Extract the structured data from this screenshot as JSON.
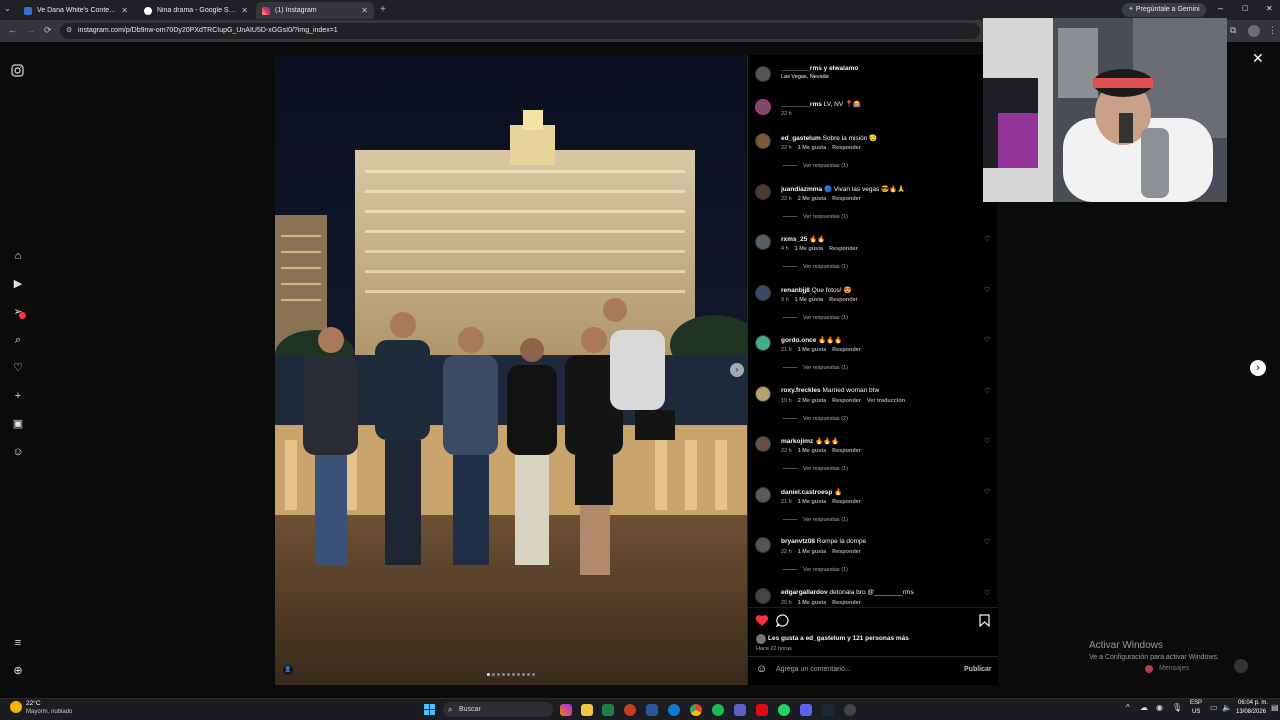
{
  "browser": {
    "tabs": [
      {
        "label": "Ve Dana White's Contender Se",
        "active": false
      },
      {
        "label": "Nina drama - Google Search",
        "active": false
      },
      {
        "label": "(1) Instagram",
        "active": true
      }
    ],
    "url": "instagram.com/p/Db9nw-om70Dy20PXdTRCIupG_UnAIU5D-xGGsI0/?img_index=1",
    "gemini_label": "Pregúntale a Gemini"
  },
  "post": {
    "header_user": "________rms y elwalamo",
    "location": "Las Vegas, Nevada",
    "caption_user": "________rms",
    "caption_text": "LV, NV 📍🎰",
    "caption_time": "22 h",
    "likes_text": "Les gusta a ed_gastelum y 121 personas más",
    "posted_time": "Hace 22 horas",
    "comment_placeholder": "Agrega un comentario...",
    "publish_label": "Publicar"
  },
  "comments": [
    {
      "user": "ed_gastelum",
      "text": "Sobre la misión 🫡",
      "time": "22 h",
      "likes": "1 Me gusta",
      "reply": "Responder",
      "replies": "Ver respuestas (1)",
      "heart": false
    },
    {
      "user": "juandiazmma",
      "text": "🔵 Vivan las vegas 😎🔥🙏",
      "time": "22 h",
      "likes": "2 Me gusta",
      "reply": "Responder",
      "replies": "Ver respuestas (1)",
      "heart": false
    },
    {
      "user": "rxms_25",
      "text": "🔥🔥",
      "time": "4 h",
      "likes": "1 Me gusta",
      "reply": "Responder",
      "replies": "Ver respuestas (1)",
      "heart": true
    },
    {
      "user": "renanbjj8",
      "text": "Que fotos! 😍",
      "time": "9 h",
      "likes": "1 Me gusta",
      "reply": "Responder",
      "replies": "Ver respuestas (1)",
      "heart": true
    },
    {
      "user": "gordo.once",
      "text": "🔥🔥🔥",
      "time": "21 h",
      "likes": "1 Me gusta",
      "reply": "Responder",
      "replies": "Ver respuestas (1)",
      "heart": true
    },
    {
      "user": "roxy.freckles",
      "text": "Married woman btw",
      "time": "19 h",
      "likes": "2 Me gusta",
      "reply": "Responder",
      "translate": "Ver traducción",
      "replies": "Ver respuestas (2)",
      "heart": true
    },
    {
      "user": "markojimz",
      "text": "🔥🔥🔥",
      "time": "22 h",
      "likes": "1 Me gusta",
      "reply": "Responder",
      "replies": "Ver respuestas (1)",
      "heart": true
    },
    {
      "user": "daniel.castroesp",
      "text": "🔥",
      "time": "21 h",
      "likes": "1 Me gusta",
      "reply": "Responder",
      "replies": "Ver respuestas (1)",
      "heart": true
    },
    {
      "user": "bryanvtz08",
      "text": "Rompe la dompe",
      "time": "22 h",
      "likes": "1 Me gusta",
      "reply": "Responder",
      "replies": "Ver respuestas (1)",
      "heart": true
    },
    {
      "user": "edgargallardov",
      "text": "detonala bro @________rms",
      "time": "20 h",
      "likes": "1 Me gusta",
      "reply": "Responder",
      "replies": "",
      "heart": true
    }
  ],
  "windows": {
    "activate_title": "Activar Windows",
    "activate_sub": "Ve a Configuración para activar Windows.",
    "messages_label": "Mensajes",
    "weather_temp": "22°C",
    "weather_desc": "Mayorm. nublado",
    "search_label": "Buscar",
    "lang": "ESP",
    "region": "US",
    "time": "06:04 p. m.",
    "date": "13/08/2026"
  },
  "colors": {
    "like_red": "#ff3040",
    "ig_bg": "#000000",
    "link_blue": "#8ab4f8"
  }
}
